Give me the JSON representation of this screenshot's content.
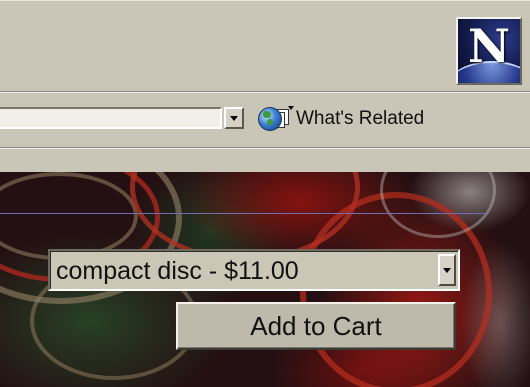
{
  "browser": {
    "logo_letter": "N",
    "location": {
      "value": ""
    },
    "whats_related": {
      "label": "What's Related",
      "icon": "globe-related-icon"
    }
  },
  "page": {
    "product_format_select": {
      "selected": "compact disc - $11.00"
    },
    "add_to_cart_label": "Add to Cart"
  },
  "colors": {
    "chrome_background": "#c9c5b7",
    "rule_line": "#6d6fb2",
    "button_face": "#bdb9ab"
  }
}
